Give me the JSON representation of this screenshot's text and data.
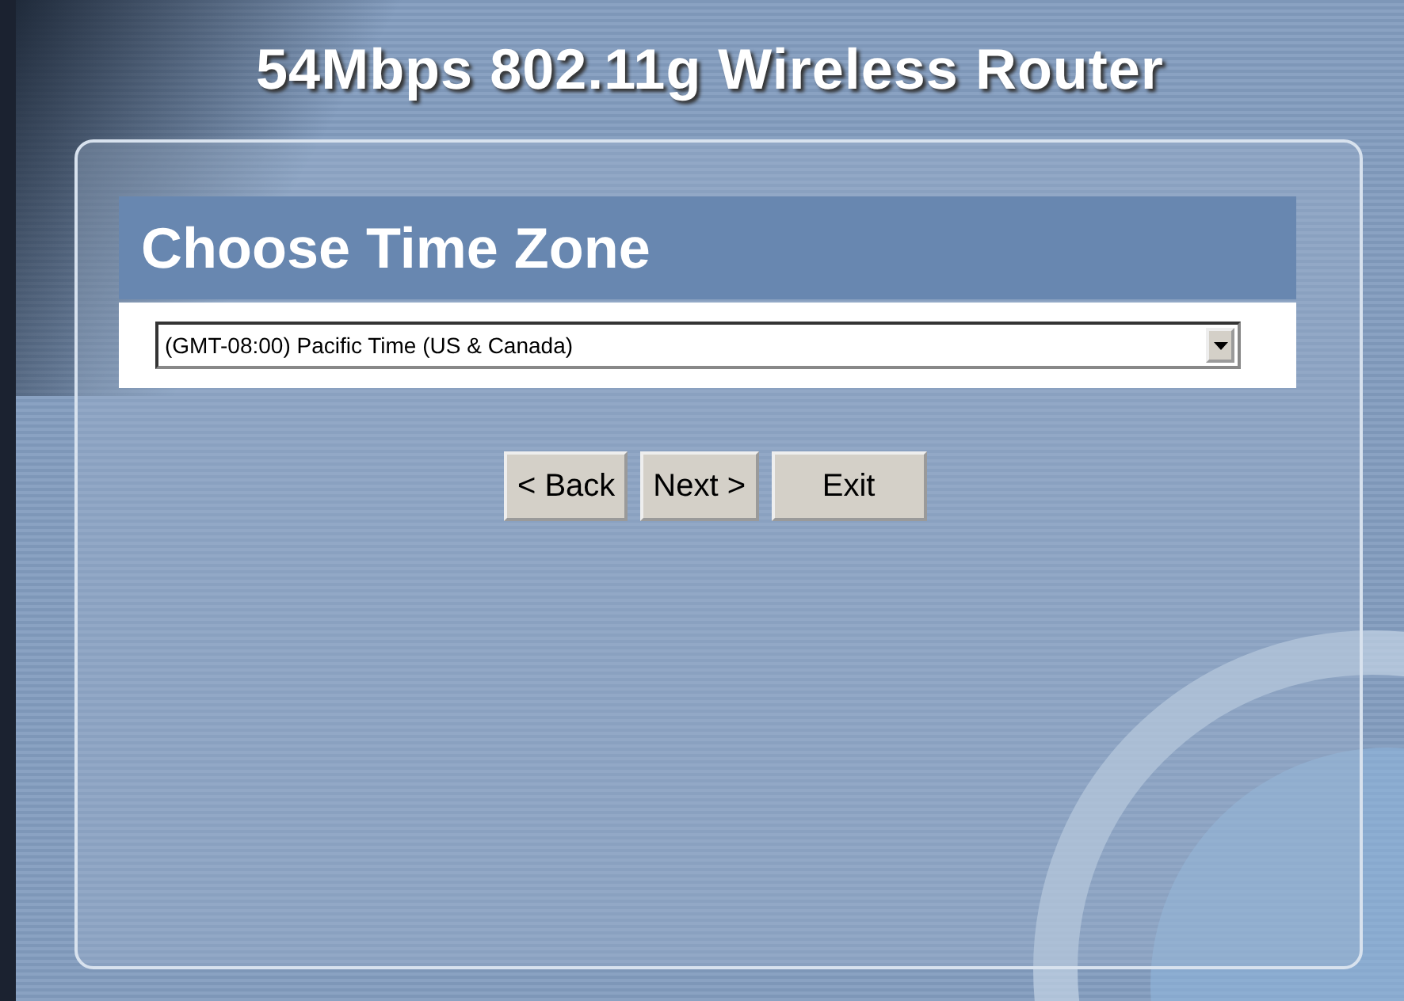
{
  "header": {
    "title": "54Mbps 802.11g Wireless Router"
  },
  "section": {
    "title": "Choose Time Zone"
  },
  "time_zone_select": {
    "value": "(GMT-08:00) Pacific Time (US & Canada)"
  },
  "buttons": [
    "< Back",
    "Next >",
    "Exit"
  ]
}
